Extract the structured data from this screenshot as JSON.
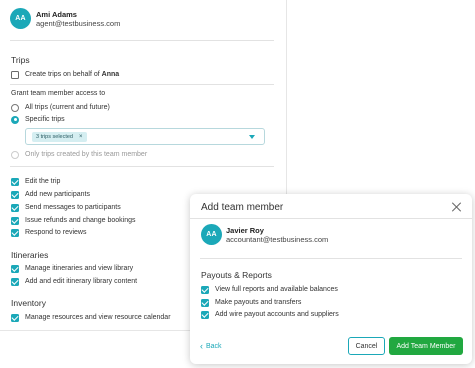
{
  "back_panel": {
    "user": {
      "initials": "AA",
      "name": "Ami Adams",
      "email": "agent@testbusiness.com"
    },
    "trips_section": {
      "title": "Trips",
      "create_on_behalf_prefix": "Create trips on behalf of ",
      "create_on_behalf_name": "Anna",
      "create_on_behalf_checked": false
    },
    "grant_access": {
      "title": "Grant team member access to",
      "options": [
        {
          "label": "All trips (current and future)",
          "state": "unselected"
        },
        {
          "label": "Specific trips",
          "state": "selected"
        },
        {
          "label": "Only trips created by this team member",
          "state": "disabled"
        }
      ],
      "selected_chip": "3 trips selected",
      "chip_remove": "×"
    },
    "trip_permissions": [
      {
        "label": "Edit the trip",
        "checked": true
      },
      {
        "label": "Add new participants",
        "checked": true
      },
      {
        "label": "Send messages to participants",
        "checked": true
      },
      {
        "label": "Issue refunds and change bookings",
        "checked": true
      },
      {
        "label": "Respond to reviews",
        "checked": true
      }
    ],
    "itineraries": {
      "title": "Itineraries",
      "items": [
        {
          "label": "Manage itineraries and view library",
          "checked": true
        },
        {
          "label": "Add and edit itinerary library content",
          "checked": true
        }
      ]
    },
    "inventory": {
      "title": "Inventory",
      "items": [
        {
          "label": "Manage resources and view resource calendar",
          "checked": true
        }
      ]
    }
  },
  "modal": {
    "title": "Add team member",
    "user": {
      "initials": "AA",
      "name": "Javier Roy",
      "email": "accountant@testbusiness.com"
    },
    "payouts_section": {
      "title": "Payouts & Reports",
      "items": [
        {
          "label": "View full reports and available balances",
          "checked": true
        },
        {
          "label": "Make payouts and transfers",
          "checked": true
        },
        {
          "label": "Add wire payout accounts and suppliers",
          "checked": true
        }
      ]
    },
    "back_label": "Back",
    "cancel_label": "Cancel",
    "submit_label": "Add Team Member"
  },
  "colors": {
    "accent": "#1ba8b8",
    "primary_button": "#21a840"
  }
}
